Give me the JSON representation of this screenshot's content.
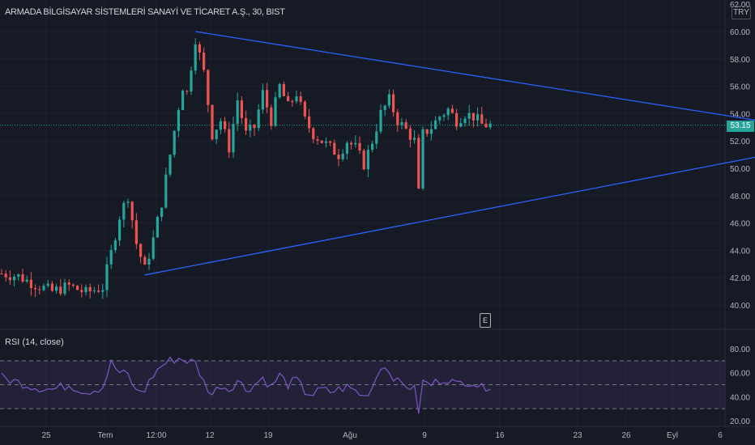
{
  "header": {
    "title": "ARMADA BİLGİSAYAR SİSTEMLERİ SANAYİ VE TİCARET A.Ş., 30, BIST"
  },
  "currency_badge": "TRY",
  "event_badge": "E",
  "last_price": "53.15",
  "colors": {
    "up": "#26a69a",
    "down": "#ef5350",
    "pattern": "#2962ff",
    "rsi": "#7e57c2",
    "background": "#161a25",
    "text": "#b2b5be",
    "grid": "#1f2330"
  },
  "chart_data": [
    {
      "type": "candlestick",
      "title": "ARMADA BİLGİSAYAR SİSTEMLERİ SANAYİ VE TİCARET A.Ş., 30, BIST",
      "price_axis_ticks": [
        "62.00",
        "60.00",
        "58.00",
        "56.00",
        "54.00",
        "52.00",
        "50.00",
        "48.00",
        "46.00",
        "44.00",
        "42.00",
        "40.00"
      ],
      "time_axis_ticks": [
        "25",
        "Tem",
        "12:00",
        "12",
        "19",
        "Ağu",
        "9",
        "16",
        "23",
        "26",
        "Eyl",
        "6"
      ],
      "ylim": [
        39.5,
        62.2
      ],
      "last_price": 53.15,
      "price_path": [
        [
          0,
          42.3
        ],
        [
          4,
          42.1
        ],
        [
          8,
          41.5
        ],
        [
          12,
          41.0
        ],
        [
          16,
          41.4
        ],
        [
          20,
          40.9
        ],
        [
          24,
          41.3
        ],
        [
          26,
          43.8
        ],
        [
          28,
          46.5
        ],
        [
          30,
          48.0
        ],
        [
          32,
          44.5
        ],
        [
          34,
          42.6
        ],
        [
          36,
          44.8
        ],
        [
          38,
          47.5
        ],
        [
          40,
          51.0
        ],
        [
          42,
          54.5
        ],
        [
          43,
          56.0
        ],
        [
          44,
          55.5
        ],
        [
          46,
          59.5
        ],
        [
          48,
          57.0
        ],
        [
          50,
          52.5
        ],
        [
          52,
          53.5
        ],
        [
          54,
          51.5
        ],
        [
          56,
          55.0
        ],
        [
          58,
          52.5
        ],
        [
          60,
          53.0
        ],
        [
          62,
          55.5
        ],
        [
          64,
          53.5
        ],
        [
          66,
          56.0
        ],
        [
          68,
          54.5
        ],
        [
          70,
          55.5
        ],
        [
          72,
          53.5
        ],
        [
          74,
          52.5
        ],
        [
          76,
          52.0
        ],
        [
          78,
          51.5
        ],
        [
          80,
          51.0
        ],
        [
          82,
          52.0
        ],
        [
          84,
          51.5
        ],
        [
          86,
          50.3
        ],
        [
          88,
          52.0
        ],
        [
          90,
          54.0
        ],
        [
          92,
          55.0
        ],
        [
          94,
          53.5
        ],
        [
          96,
          52.8
        ],
        [
          98,
          52.0
        ],
        [
          99,
          48.2
        ],
        [
          100,
          52.5
        ],
        [
          102,
          53.0
        ],
        [
          104,
          53.8
        ],
        [
          106,
          54.3
        ],
        [
          108,
          53.5
        ],
        [
          110,
          54.0
        ],
        [
          112,
          53.8
        ],
        [
          114,
          53.2
        ],
        [
          116,
          53.15
        ]
      ],
      "annotations": {
        "triangle": [
          {
            "from": {
              "x": 46,
              "y": 60.0
            },
            "to": {
              "x": 204,
              "y": 52.3
            }
          },
          {
            "from": {
              "x": 34,
              "y": 42.2
            },
            "to": {
              "x": 204,
              "y": 52.3
            }
          }
        ]
      }
    },
    {
      "type": "line",
      "title": "RSI (14, close)",
      "series": [
        {
          "name": "RSI (14, close)",
          "path": [
            [
              0,
              56
            ],
            [
              4,
              52
            ],
            [
              8,
              48
            ],
            [
              12,
              46
            ],
            [
              16,
              50
            ],
            [
              20,
              44
            ],
            [
              24,
              48
            ],
            [
              26,
              68
            ],
            [
              28,
              60
            ],
            [
              30,
              58
            ],
            [
              32,
              44
            ],
            [
              34,
              46
            ],
            [
              36,
              58
            ],
            [
              38,
              66
            ],
            [
              40,
              70
            ],
            [
              42,
              72
            ],
            [
              44,
              70
            ],
            [
              46,
              68
            ],
            [
              48,
              52
            ],
            [
              50,
              42
            ],
            [
              52,
              50
            ],
            [
              54,
              46
            ],
            [
              56,
              54
            ],
            [
              58,
              46
            ],
            [
              60,
              50
            ],
            [
              62,
              56
            ],
            [
              64,
              48
            ],
            [
              66,
              58
            ],
            [
              68,
              50
            ],
            [
              70,
              54
            ],
            [
              72,
              44
            ],
            [
              74,
              42
            ],
            [
              76,
              46
            ],
            [
              78,
              44
            ],
            [
              80,
              46
            ],
            [
              82,
              48
            ],
            [
              84,
              45
            ],
            [
              86,
              40
            ],
            [
              88,
              48
            ],
            [
              90,
              66
            ],
            [
              92,
              62
            ],
            [
              94,
              52
            ],
            [
              96,
              50
            ],
            [
              98,
              46
            ],
            [
              99,
              28
            ],
            [
              100,
              52
            ],
            [
              102,
              50
            ],
            [
              104,
              54
            ],
            [
              106,
              55
            ],
            [
              108,
              50
            ],
            [
              110,
              53
            ],
            [
              112,
              52
            ],
            [
              114,
              47
            ],
            [
              116,
              50
            ]
          ]
        }
      ],
      "y_axis_ticks": [
        "80.00",
        "60.00",
        "40.00",
        "20.00"
      ],
      "ylim": [
        15,
        90
      ],
      "levels": [
        70,
        50,
        30
      ]
    }
  ]
}
